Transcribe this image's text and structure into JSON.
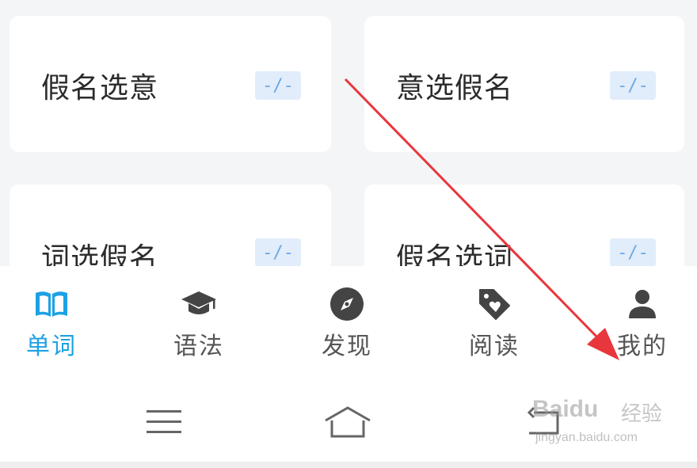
{
  "cards": [
    {
      "title": "假名选意",
      "badge": "-/-"
    },
    {
      "title": "意选假名",
      "badge": "-/-"
    },
    {
      "title": "词选假名",
      "badge": "-/-"
    },
    {
      "title": "假名选词",
      "badge": "-/-"
    }
  ],
  "tabs": [
    {
      "label": "单词",
      "icon": "book-icon",
      "active": true
    },
    {
      "label": "语法",
      "icon": "graduation-cap-icon",
      "active": false
    },
    {
      "label": "发现",
      "icon": "compass-icon",
      "active": false
    },
    {
      "label": "阅读",
      "icon": "tag-heart-icon",
      "active": false
    },
    {
      "label": "我的",
      "icon": "user-icon",
      "active": false
    }
  ],
  "navbar": {
    "icons": [
      "menu-icon",
      "home-icon",
      "back-icon"
    ]
  },
  "watermark": {
    "brand": "Baidu",
    "brand_cn": "经验",
    "url": "jingyan.baidu.com"
  },
  "colors": {
    "accent": "#1da1e4",
    "arrow": "#e8363d",
    "badge_bg": "#e1edfa",
    "badge_text": "#6aa9e9"
  }
}
